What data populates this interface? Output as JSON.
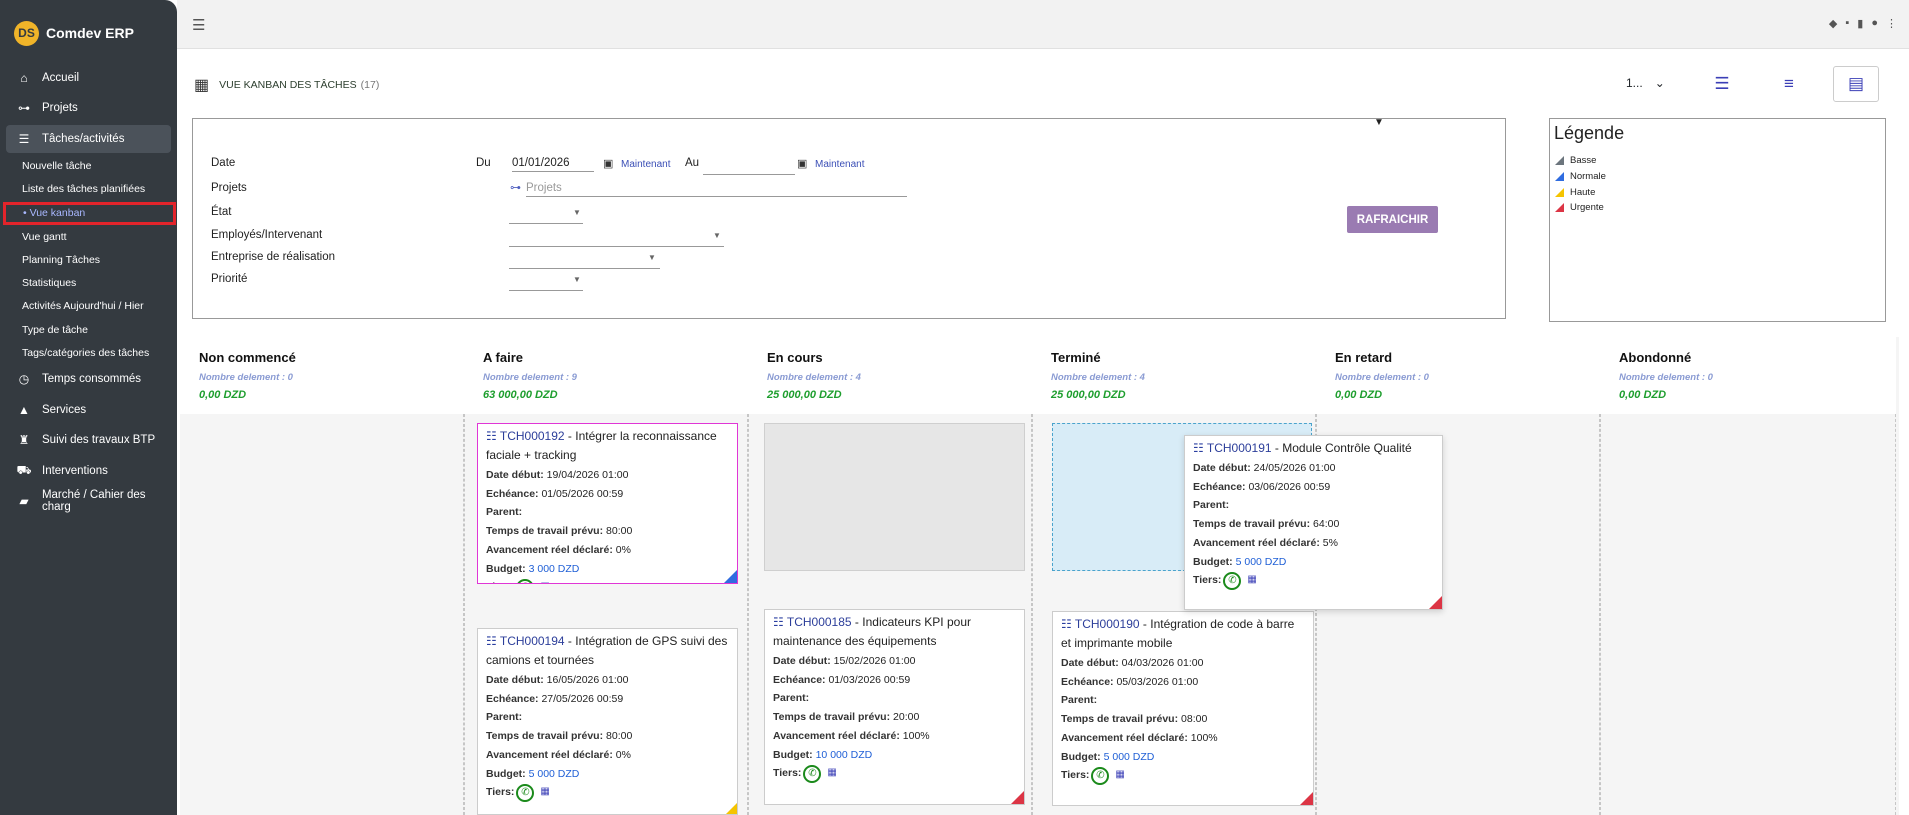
{
  "app": {
    "name": "Comdev ERP",
    "logo_text": "DS"
  },
  "sidebar": {
    "items": [
      {
        "label": "Accueil",
        "icon": "home-icon"
      },
      {
        "label": "Projets",
        "icon": "sitemap-icon"
      },
      {
        "label": "Tâches/activités",
        "icon": "tasks-icon"
      },
      {
        "label": "Temps consommés",
        "icon": "clock-icon"
      },
      {
        "label": "Services",
        "icon": "services-icon"
      },
      {
        "label": "Suivi des travaux BTP",
        "icon": "workers-icon"
      },
      {
        "label": "Interventions",
        "icon": "truck-icon"
      },
      {
        "label": "Marché / Cahier des charg",
        "icon": "book-icon"
      }
    ],
    "subitems": [
      {
        "label": "Nouvelle tâche"
      },
      {
        "label": "Liste des tâches planifiées"
      },
      {
        "label": "Vue kanban"
      },
      {
        "label": "Vue gantt"
      },
      {
        "label": "Planning Tâches"
      },
      {
        "label": "Statistiques"
      },
      {
        "label": "Activités Aujourd'hui / Hier"
      },
      {
        "label": "Type de tâche"
      },
      {
        "label": "Tags/catégories des tâches"
      }
    ]
  },
  "header": {
    "title": "VUE KANBAN DES TÂCHES",
    "count": "(17)",
    "page_select": "1..."
  },
  "filter": {
    "date_label": "Date",
    "du_label": "Du",
    "du_value": "01/01/2026",
    "au_label": "Au",
    "au_value": "",
    "now_label": "Maintenant",
    "projets_label": "Projets",
    "projets_placeholder": "Projets",
    "etat_label": "État",
    "employes_label": "Employés/Intervenant",
    "entreprise_label": "Entreprise de réalisation",
    "priorite_label": "Priorité",
    "refresh_label": "RAFRAICHIR"
  },
  "legend": {
    "title": "Légende",
    "items": [
      {
        "label": "Basse",
        "color": "#6c757d"
      },
      {
        "label": "Normale",
        "color": "#2f6ce0"
      },
      {
        "label": "Haute",
        "color": "#f5c400"
      },
      {
        "label": "Urgente",
        "color": "#dc3545"
      }
    ]
  },
  "columns": [
    {
      "name": "Non commencé",
      "count": "Nombre delement : 0",
      "budget": "0,00 DZD"
    },
    {
      "name": "A faire",
      "count": "Nombre delement : 9",
      "budget": "63 000,00 DZD"
    },
    {
      "name": "En cours",
      "count": "Nombre delement : 4",
      "budget": "25 000,00 DZD"
    },
    {
      "name": "Terminé",
      "count": "Nombre delement : 4",
      "budget": "25 000,00 DZD"
    },
    {
      "name": "En retard",
      "count": "Nombre delement : 0",
      "budget": "0,00 DZD"
    },
    {
      "name": "Abondonné",
      "count": "Nombre delement : 0",
      "budget": "0,00 DZD"
    }
  ],
  "field_labels": {
    "start": "Date début:",
    "due": "Echéance:",
    "parent": "Parent:",
    "planned": "Temps de travail prévu:",
    "progress": "Avancement réel déclaré:",
    "budget": "Budget:",
    "tiers": "Tiers:"
  },
  "cards": [
    {
      "ref": "TCH000192",
      "title": " - Intégrer la reconnaissance faciale + tracking",
      "start": "19/04/2026 01:00",
      "due": "01/05/2026 00:59",
      "parent": "",
      "planned": "80:00",
      "progress": "0%",
      "budget": "3 000 DZD",
      "priority_color": "#2f6ce0"
    },
    {
      "ref": "TCH000194",
      "title": " - Intégration de GPS suivi des camions et tournées",
      "start": "16/05/2026 01:00",
      "due": "27/05/2026 00:59",
      "parent": "",
      "planned": "80:00",
      "progress": "0%",
      "budget": "5 000 DZD",
      "priority_color": "#f5c400"
    },
    {
      "ref": "TCH000185",
      "title": " - Indicateurs KPI pour maintenance des équipements",
      "start": "15/02/2026 01:00",
      "due": "01/03/2026 00:59",
      "parent": "",
      "planned": "20:00",
      "progress": "100%",
      "budget": "10 000 DZD",
      "priority_color": "#dc3545"
    },
    {
      "ref": "TCH000190",
      "title": " - Intégration de code à barre et imprimante mobile",
      "start": "04/03/2026 01:00",
      "due": "05/03/2026 01:00",
      "parent": "",
      "planned": "08:00",
      "progress": "100%",
      "budget": "5 000 DZD",
      "priority_color": "#dc3545"
    },
    {
      "ref": "TCH000191",
      "title": " - Module Contrôle Qualité",
      "start": "24/05/2026 01:00",
      "due": "03/06/2026 00:59",
      "parent": "",
      "planned": "64:00",
      "progress": "5%",
      "budget": "5 000 DZD",
      "priority_color": "#dc3545"
    }
  ]
}
